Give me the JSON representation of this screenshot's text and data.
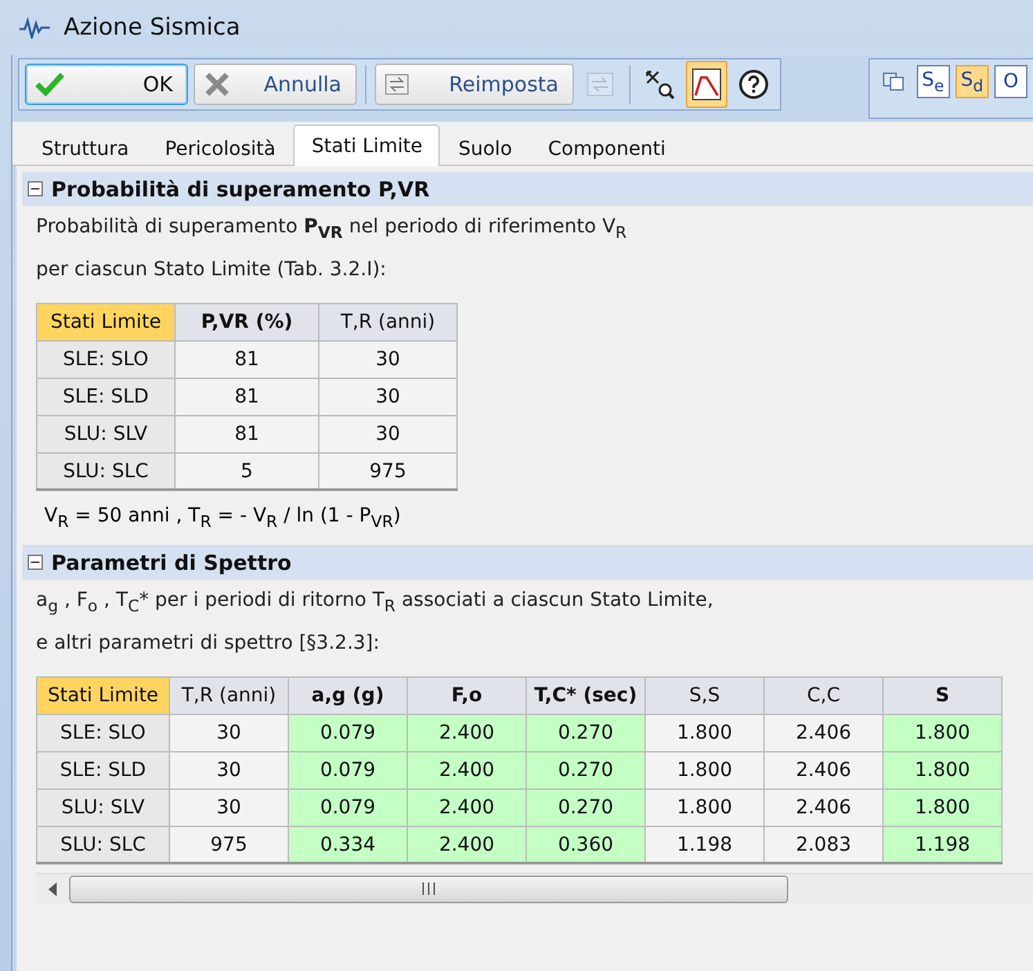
{
  "window": {
    "title": "Azione Sismica"
  },
  "toolbar": {
    "buttons": [
      {
        "kind": "ok",
        "label": "OK",
        "focused": true
      },
      {
        "kind": "cancel",
        "label": "Annulla",
        "focused": false
      },
      {
        "kind": "reset",
        "label": "Reimposta",
        "focused": false
      }
    ],
    "tools": [
      {
        "kind": "apply",
        "disabled": true,
        "selected": false
      },
      {
        "kind": "zoom",
        "disabled": false,
        "selected": false
      },
      {
        "kind": "spectrum",
        "disabled": false,
        "selected": true
      },
      {
        "kind": "help",
        "disabled": false,
        "selected": false
      }
    ],
    "right_tools": [
      {
        "kind": "copy",
        "selected": false
      },
      {
        "kind": "text",
        "label": "S$_{e}$",
        "selected": false
      },
      {
        "kind": "text",
        "label": "S$_{d}$",
        "selected": true
      },
      {
        "kind": "text",
        "label": "O",
        "selected": false
      }
    ]
  },
  "tabs": [
    {
      "label": "Struttura",
      "selected": false
    },
    {
      "label": "Pericolosità",
      "selected": false
    },
    {
      "label": "Stati Limite",
      "selected": true
    },
    {
      "label": "Suolo",
      "selected": false
    },
    {
      "label": "Componenti",
      "selected": false
    }
  ],
  "sections": [
    {
      "title": "Probabilità di superamento P,VR",
      "expanded": true,
      "intro": [
        "Probabilità di superamento **P$_{VR}$** nel periodo di riferimento V$_{R}$",
        "per ciascun Stato Limite (Tab. 3.2.I):"
      ],
      "columns": [
        {
          "label": "Stati Limite",
          "bold": false,
          "highlighted": true,
          "green": false
        },
        {
          "label": "P,VR (%)",
          "bold": true,
          "highlighted": false,
          "green": false
        },
        {
          "label": "T,R (anni)",
          "bold": false,
          "highlighted": false,
          "green": false
        }
      ],
      "rows": [
        [
          "SLE: SLO",
          "81",
          "30"
        ],
        [
          "SLE: SLD",
          "81",
          "30"
        ],
        [
          "SLU: SLV",
          "81",
          "30"
        ],
        [
          "SLU: SLC",
          "5",
          "975"
        ]
      ],
      "formula": "V$_{R}$ = 50 anni , T$_{R}$ = - V$_{R}$ / ln (1 - P$_{VR}$)"
    },
    {
      "title": "Parametri di Spettro",
      "expanded": true,
      "intro": [
        "a$_{g}$ , F$_{o}$ , T$_{C}$* per i periodi di ritorno T$_{R}$ associati a ciascun Stato Limite,",
        "e altri parametri di spettro [§3.2.3]:"
      ],
      "columns": [
        {
          "label": "Stati Limite",
          "bold": false,
          "highlighted": true,
          "green": false
        },
        {
          "label": "T,R (anni)",
          "bold": false,
          "highlighted": false,
          "green": false
        },
        {
          "label": "a,g (g)",
          "bold": true,
          "highlighted": false,
          "green": true
        },
        {
          "label": "F,o",
          "bold": true,
          "highlighted": false,
          "green": true
        },
        {
          "label": "T,C* (sec)",
          "bold": true,
          "highlighted": false,
          "green": true
        },
        {
          "label": "S,S",
          "bold": false,
          "highlighted": false,
          "green": false
        },
        {
          "label": "C,C",
          "bold": false,
          "highlighted": false,
          "green": false
        },
        {
          "label": "S",
          "bold": true,
          "highlighted": false,
          "green": true
        }
      ],
      "rows": [
        [
          "SLE: SLO",
          "30",
          "0.079",
          "2.400",
          "0.270",
          "1.800",
          "2.406",
          "1.800"
        ],
        [
          "SLE: SLD",
          "30",
          "0.079",
          "2.400",
          "0.270",
          "1.800",
          "2.406",
          "1.800"
        ],
        [
          "SLU: SLV",
          "30",
          "0.079",
          "2.400",
          "0.270",
          "1.800",
          "2.406",
          "1.800"
        ],
        [
          "SLU: SLC",
          "975",
          "0.334",
          "2.400",
          "0.360",
          "1.198",
          "2.083",
          "1.198"
        ]
      ],
      "scrollbar": true
    }
  ]
}
